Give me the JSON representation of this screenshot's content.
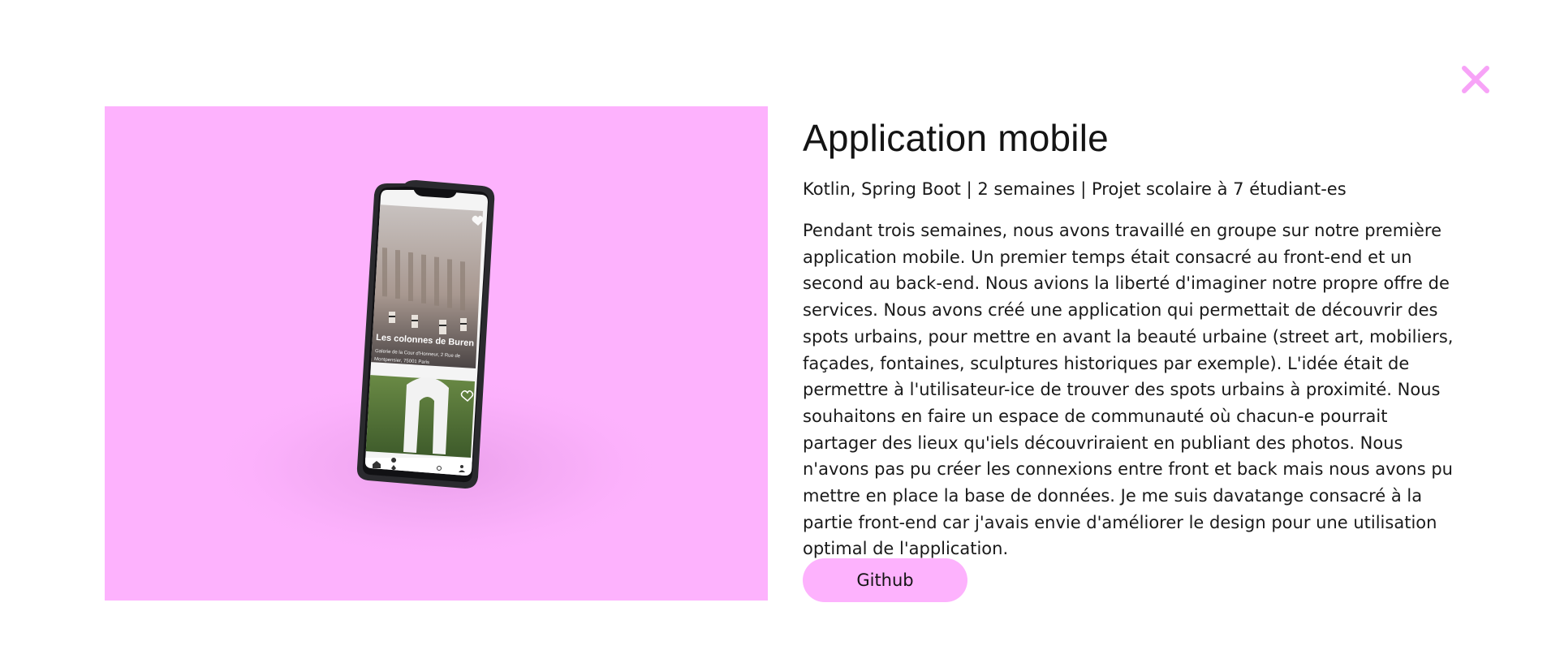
{
  "modal": {
    "close_icon": "close-x-icon",
    "accent_color": "#fdb2fd",
    "close_color": "#f7a3f7"
  },
  "media": {
    "alt": "mobile-app-mockup",
    "screen": {
      "card_title": "Les colonnes de Buren",
      "card_address_line1": "Galerie de la Cour d'Honneur, 2 Rue de",
      "card_address_line2": "Montpensier, 75001 Paris",
      "nav_icons": [
        "home-icon",
        "map-pin-icon",
        "search-icon",
        "user-icon"
      ]
    }
  },
  "project": {
    "title": "Application mobile",
    "meta": "Kotlin, Spring Boot | 2 semaines | Projet scolaire à 7 étudiant-es",
    "description": "Pendant trois semaines, nous avons travaillé en groupe sur notre première application mobile. Un premier temps était consacré au front-end et un second au back-end. Nous avions la liberté d'imaginer notre propre offre de services. Nous avons créé une application qui permettait de découvrir des spots urbains, pour mettre en avant la beauté urbaine (street art, mobiliers, façades, fontaines, sculptures historiques par exemple). L'idée était de permettre à l'utilisateur-ice de trouver des spots urbains à proximité. Nous souhaitons en faire un espace de communauté où chacun-e pourrait partager des lieux qu'iels découvriraient en publiant des photos. Nous n'avons pas pu créer les connexions entre front et back mais nous avons pu mettre en place la base de données. Je me suis davatange consacré à la partie front-end car j'avais envie d'améliorer le design pour une utilisation optimal de l'application.",
    "github_label": "Github"
  }
}
